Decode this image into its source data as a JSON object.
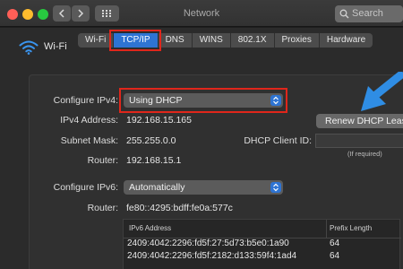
{
  "window": {
    "title": "Network"
  },
  "toolbar": {
    "search_placeholder": "Search"
  },
  "interface": {
    "name": "Wi-Fi"
  },
  "tabs": [
    {
      "label": "Wi-Fi",
      "active": false
    },
    {
      "label": "TCP/IP",
      "active": true
    },
    {
      "label": "DNS",
      "active": false
    },
    {
      "label": "WINS",
      "active": false
    },
    {
      "label": "802.1X",
      "active": false
    },
    {
      "label": "Proxies",
      "active": false
    },
    {
      "label": "Hardware",
      "active": false
    }
  ],
  "ipv4": {
    "configure_label": "Configure IPv4:",
    "configure_value": "Using DHCP",
    "address_label": "IPv4 Address:",
    "address_value": "192.168.15.165",
    "subnet_label": "Subnet Mask:",
    "subnet_value": "255.255.0.0",
    "router_label": "Router:",
    "router_value": "192.168.15.1",
    "renew_button": "Renew DHCP Lease",
    "client_id_label": "DHCP Client ID:",
    "client_id_value": "",
    "client_id_hint": "(If required)"
  },
  "ipv6": {
    "configure_label": "Configure IPv6:",
    "configure_value": "Automatically",
    "router_label": "Router:",
    "router_value": "fe80::4295:bdff:fe0a:577c",
    "table_headers": [
      "IPv6 Address",
      "Prefix Length"
    ],
    "table_rows": [
      [
        "2409:4042:2296:fd5f:27:5d73:b5e0:1a90",
        "64"
      ],
      [
        "2409:4042:2296:fd5f:2182:d133:59f4:1ad4",
        "64"
      ]
    ]
  },
  "colors": {
    "accent": "#2e74d3",
    "highlight_box": "#e0261b",
    "annotation_arrow": "#2f8de4"
  },
  "icons": [
    "wifi-icon",
    "search-icon",
    "chevron-left-icon",
    "chevron-right-icon",
    "grid-icon",
    "select-arrows-icon",
    "pointer-arrow-icon"
  ]
}
